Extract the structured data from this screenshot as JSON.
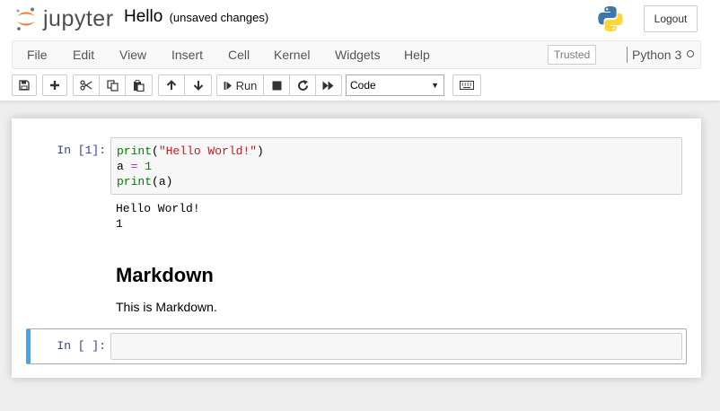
{
  "header": {
    "logo_text": "jupyter",
    "notebook_title": "Hello",
    "save_status": "(unsaved changes)",
    "logout_label": "Logout"
  },
  "menubar": {
    "items": [
      "File",
      "Edit",
      "View",
      "Insert",
      "Cell",
      "Kernel",
      "Widgets",
      "Help"
    ],
    "trusted_label": "Trusted",
    "kernel_name": "Python 3"
  },
  "toolbar": {
    "buttons": [
      "save-icon",
      "add-cell-icon",
      "cut-icon",
      "copy-icon",
      "paste-icon",
      "move-up-icon",
      "move-down-icon",
      "run-icon",
      "stop-icon",
      "restart-icon",
      "fast-forward-icon",
      "keyboard-icon"
    ],
    "run_label": "Run",
    "cell_type": "Code"
  },
  "cells": [
    {
      "type": "code",
      "prompt": "In [1]:",
      "source_lines": [
        "print(\"Hello World!\")",
        "a = 1",
        "print(a)"
      ],
      "outputs": [
        "Hello World!",
        "1"
      ]
    },
    {
      "type": "markdown",
      "heading": "Markdown",
      "text": "This is Markdown."
    },
    {
      "type": "code",
      "prompt": "In [ ]:",
      "source_lines": []
    }
  ],
  "colors": {
    "prompt": "#303f9f",
    "selected_cell_bar": "#42a5f5",
    "string": "#ba2121",
    "builtin": "#008000",
    "operator": "#aa22ff"
  }
}
